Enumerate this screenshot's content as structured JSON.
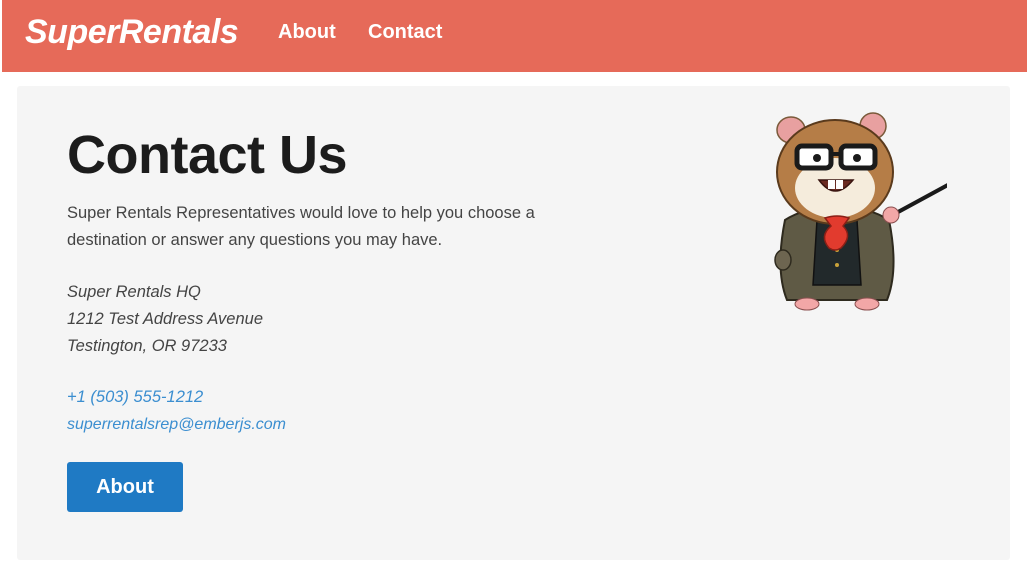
{
  "menu": {
    "brand": "SuperRentals",
    "links": [
      {
        "label": "About"
      },
      {
        "label": "Contact"
      }
    ],
    "background_color": "#e66a59"
  },
  "main": {
    "title": "Contact Us",
    "intro": "Super Rentals Representatives would love to help you choose a destination or answer any questions you may have.",
    "address": {
      "name": "Super Rentals HQ",
      "street": "1212 Test Address Avenue",
      "city": "Testington, OR 97233"
    },
    "phone": "+1 (503) 555-1212",
    "email": "superrentalsrep@emberjs.com",
    "button_label": "About",
    "button_color": "#1f7ac4",
    "illustration": "tomster-teacher-mascot"
  }
}
